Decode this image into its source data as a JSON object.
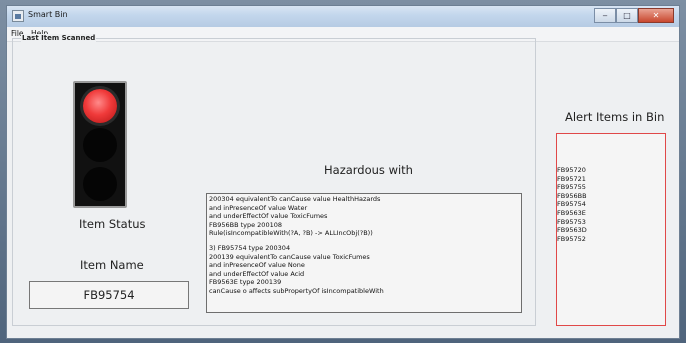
{
  "window": {
    "title": "Smart Bin"
  },
  "menu": [
    "File",
    "Help"
  ],
  "panel": {
    "title": "Last Item Scanned"
  },
  "traffic_light": {
    "state": "red"
  },
  "labels": {
    "item_status": "Item Status",
    "item_name": "Item Name",
    "hazardous_with": "Hazardous with",
    "alert_items": "Alert Items in Bin"
  },
  "item_name_value": "FB95754",
  "hazard_lines": [
    "200304 equivalentTo canCause value HealthHazards",
    "and inPresenceOf value Water",
    "and underEffectOf value ToxicFumes",
    "FB956BB type 200108",
    "Rule(isIncompatibleWith(?A, ?B) -> ALLIncObj(?B))",
    "",
    "3) FB95754 type 200304",
    "200139 equivalentTo canCause value ToxicFumes",
    "and inPresenceOf value None",
    "and underEffectOf value Acid",
    "FB9563E type 200139",
    "canCause o affects subPropertyOf isIncompatibleWith"
  ],
  "alert_items": [
    "FB95720",
    "FB95721",
    "FB95755",
    "FB956BB",
    "FB95754",
    "FB9563E",
    "FB95753",
    "FB9563D",
    "FB95752"
  ],
  "colors": {
    "alert_border": "#e04848",
    "lamp_active": "#f03a3a"
  }
}
